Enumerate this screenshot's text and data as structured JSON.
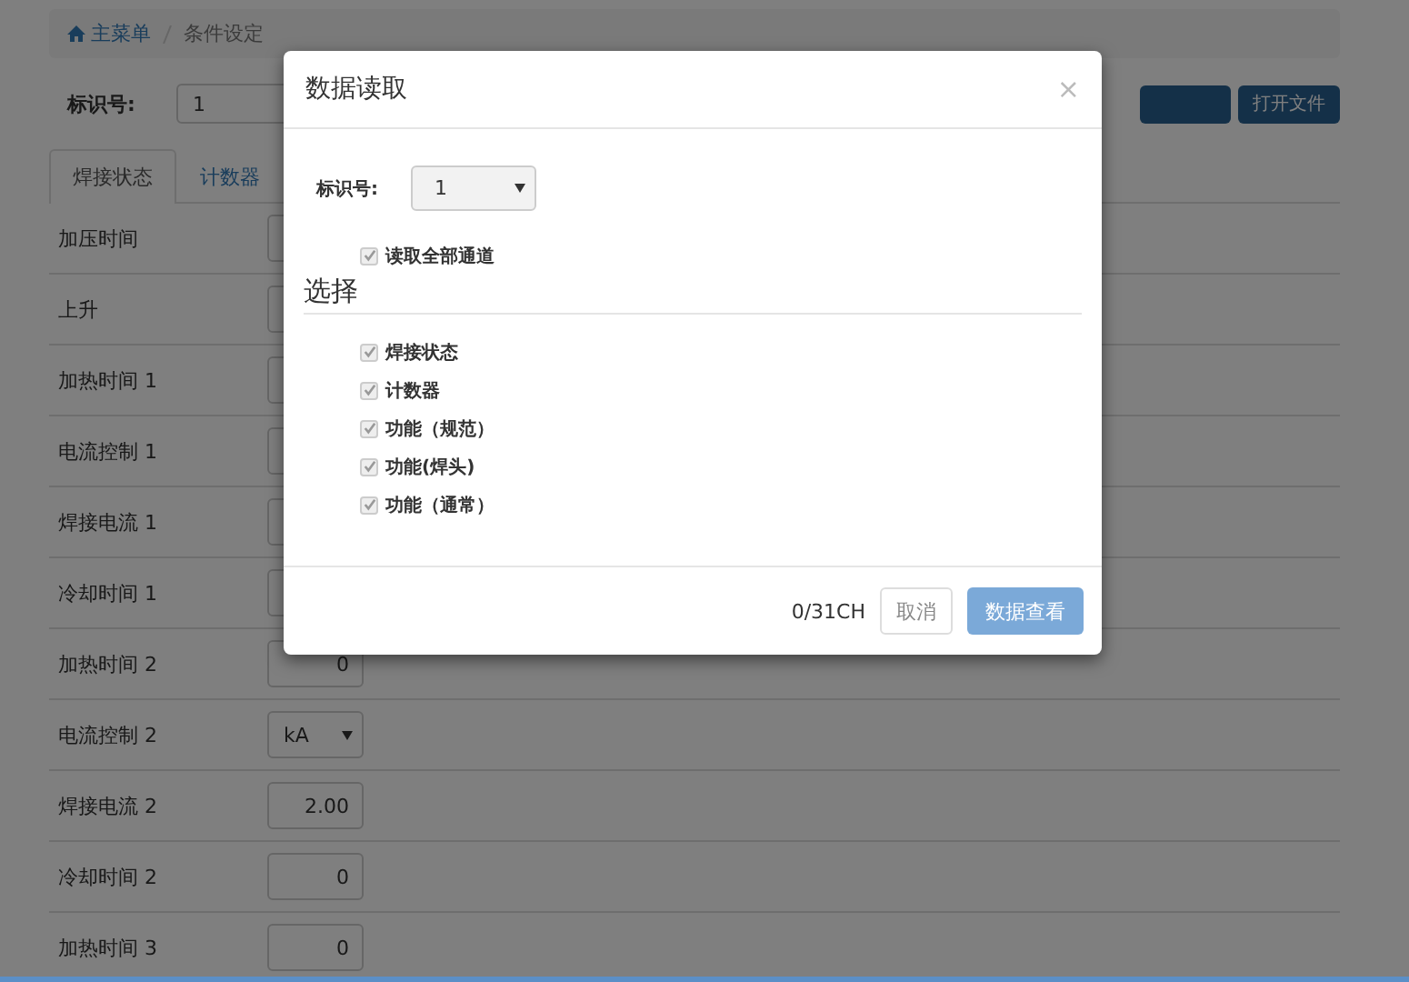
{
  "breadcrumb": [
    {
      "label": "主菜单"
    },
    {
      "label": "条件设定"
    }
  ],
  "id_field": {
    "label": "标识号:",
    "value": "1"
  },
  "buttons": [
    {
      "kind": "covered"
    },
    {
      "kind": "text",
      "label": "打开文件"
    }
  ],
  "tabs": [
    {
      "label": "焊接状态",
      "selected": true
    },
    {
      "label": "计数器",
      "selected": false
    }
  ],
  "rows": [
    {
      "label": "加压时间",
      "kind": "input"
    },
    {
      "label": "上升",
      "kind": "input"
    },
    {
      "label": "加热时间 1",
      "kind": "input"
    },
    {
      "label": "电流控制 1",
      "kind": "input"
    },
    {
      "label": "焊接电流 1",
      "kind": "input"
    },
    {
      "label": "冷却时间 1",
      "kind": "input"
    },
    {
      "label": "加热时间 2",
      "kind": "input",
      "value": "0"
    },
    {
      "label": "电流控制 2",
      "kind": "select",
      "value": "kA"
    },
    {
      "label": "焊接电流 2",
      "kind": "input",
      "value": "2.00"
    },
    {
      "label": "冷却时间 2",
      "kind": "input",
      "value": "0"
    },
    {
      "label": "加热时间 3",
      "kind": "input",
      "value": "0"
    }
  ],
  "dialog": {
    "title": "数据读取",
    "close": "×",
    "id_label": "标识号:",
    "id_value": "1",
    "read_all": {
      "label": "读取全部通道",
      "checked": true
    },
    "section": "选择",
    "options": [
      {
        "label": "焊接状态",
        "checked": true
      },
      {
        "label": "计数器",
        "checked": true
      },
      {
        "label": "功能（规范）",
        "checked": true
      },
      {
        "label": "功能(焊头)",
        "checked": true
      },
      {
        "label": "功能（通常）",
        "checked": true
      }
    ],
    "counter": "0/31CH",
    "cancel": "取消",
    "confirm": "数据查看"
  }
}
